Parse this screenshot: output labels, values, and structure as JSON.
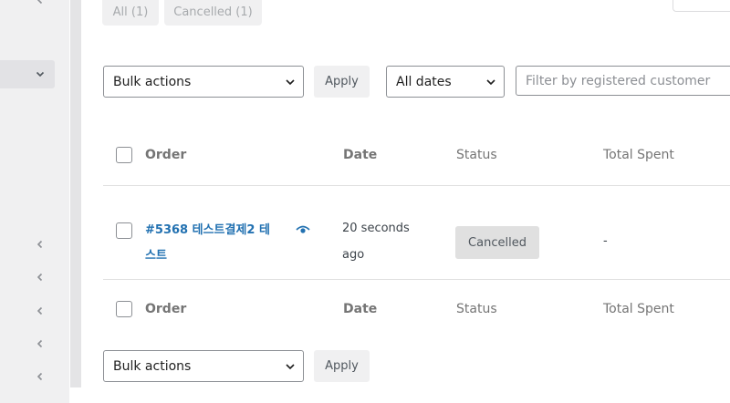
{
  "filters": {
    "all_label": "All (1)",
    "cancelled_label": "Cancelled (1)"
  },
  "toolbar_top": {
    "bulk_actions": "Bulk actions",
    "apply": "Apply",
    "dates": "All dates",
    "customer_placeholder": "Filter by registered customer"
  },
  "table": {
    "header": {
      "order": "Order",
      "date": "Date",
      "status": "Status",
      "total": "Total Spent"
    },
    "rows": [
      {
        "order_line1": "#5368 테스트결제2 테",
        "order_line2": "스트",
        "date_line1": "20 seconds",
        "date_line2": "ago",
        "status": "Cancelled",
        "total": "-"
      }
    ],
    "footer": {
      "order": "Order",
      "date": "Date",
      "status": "Status",
      "total": "Total Spent"
    }
  },
  "toolbar_bottom": {
    "bulk_actions": "Bulk actions",
    "apply": "Apply"
  },
  "colors": {
    "link": "#2271b1",
    "sidebar_bg": "#f0f0f1",
    "status_cancelled_bg": "#e0e0e0"
  }
}
